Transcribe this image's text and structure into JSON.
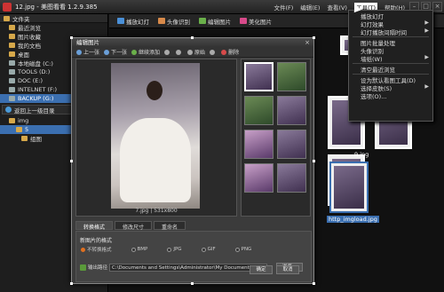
{
  "window": {
    "title": "12.jpg - 美图看看 1.2.9.385"
  },
  "menu": {
    "items": [
      "文件(F)",
      "编辑(E)",
      "查看(V)",
      "工具(T)",
      "帮助(H)"
    ],
    "active_index": 3
  },
  "toolbar": {
    "items": [
      "播放幻灯",
      "头像识别",
      "编辑图片",
      "美化图片"
    ]
  },
  "sidebar": {
    "header": "文件夹",
    "items": [
      {
        "label": "最近浏览",
        "level": 1
      },
      {
        "label": "图片收藏",
        "level": 1
      },
      {
        "label": "我的文档",
        "level": 1
      },
      {
        "label": "桌面",
        "level": 1
      },
      {
        "label": "本地磁盘 (C:)",
        "level": 1
      },
      {
        "label": "TOOLS (D:)",
        "level": 1
      },
      {
        "label": "DOC (E:)",
        "level": 1
      },
      {
        "label": "INTELNET (F:)",
        "level": 1
      },
      {
        "label": "BACKUP (G:)",
        "level": 1,
        "selected": true
      }
    ],
    "up_level": "返回上一级目录",
    "tree": [
      {
        "label": "img",
        "level": 1
      },
      {
        "label": "5",
        "level": 2,
        "selected": true
      },
      {
        "label": "组图",
        "level": 3
      }
    ]
  },
  "tools_menu": {
    "items": [
      {
        "label": "播放幻灯",
        "submenu": false
      },
      {
        "label": "幻灯效果",
        "submenu": true
      },
      {
        "label": "幻灯播放间隔时间",
        "submenu": true
      },
      {
        "sep": true
      },
      {
        "label": "图片批量处理",
        "submenu": false
      },
      {
        "label": "头像识别",
        "submenu": false
      },
      {
        "label": "墙纸(W)",
        "submenu": true
      },
      {
        "sep": true
      },
      {
        "label": "清空最近浏览",
        "submenu": false
      },
      {
        "sep": true
      },
      {
        "label": "设为默认看图工具(D)",
        "submenu": false
      },
      {
        "label": "选择皮肤(S)",
        "submenu": true
      },
      {
        "label": "选项(O)...",
        "submenu": false
      }
    ]
  },
  "main": {
    "captions": [
      "9.jpg",
      "http_imgload.jpg"
    ]
  },
  "dialog": {
    "title": "编辑图片",
    "toolbar": [
      "上一张",
      "下一张",
      "继续添加",
      "",
      "",
      "原始",
      "",
      "删除"
    ],
    "preview_caption": "7.jpg | 531x800",
    "tabs": [
      "转换格式",
      "修改尺寸",
      "重命名"
    ],
    "format_label": "新图片的格式",
    "formats": [
      "不转换格式",
      "BMP",
      "JPG",
      "GIF",
      "PNG"
    ],
    "format_selected": 0,
    "output_label": "输出路径",
    "output_path": "C:\\Documents and Settings\\Administrator\\My Documents\\My Pictures",
    "browse": "浏览...",
    "ok": "确定",
    "cancel": "取消"
  }
}
